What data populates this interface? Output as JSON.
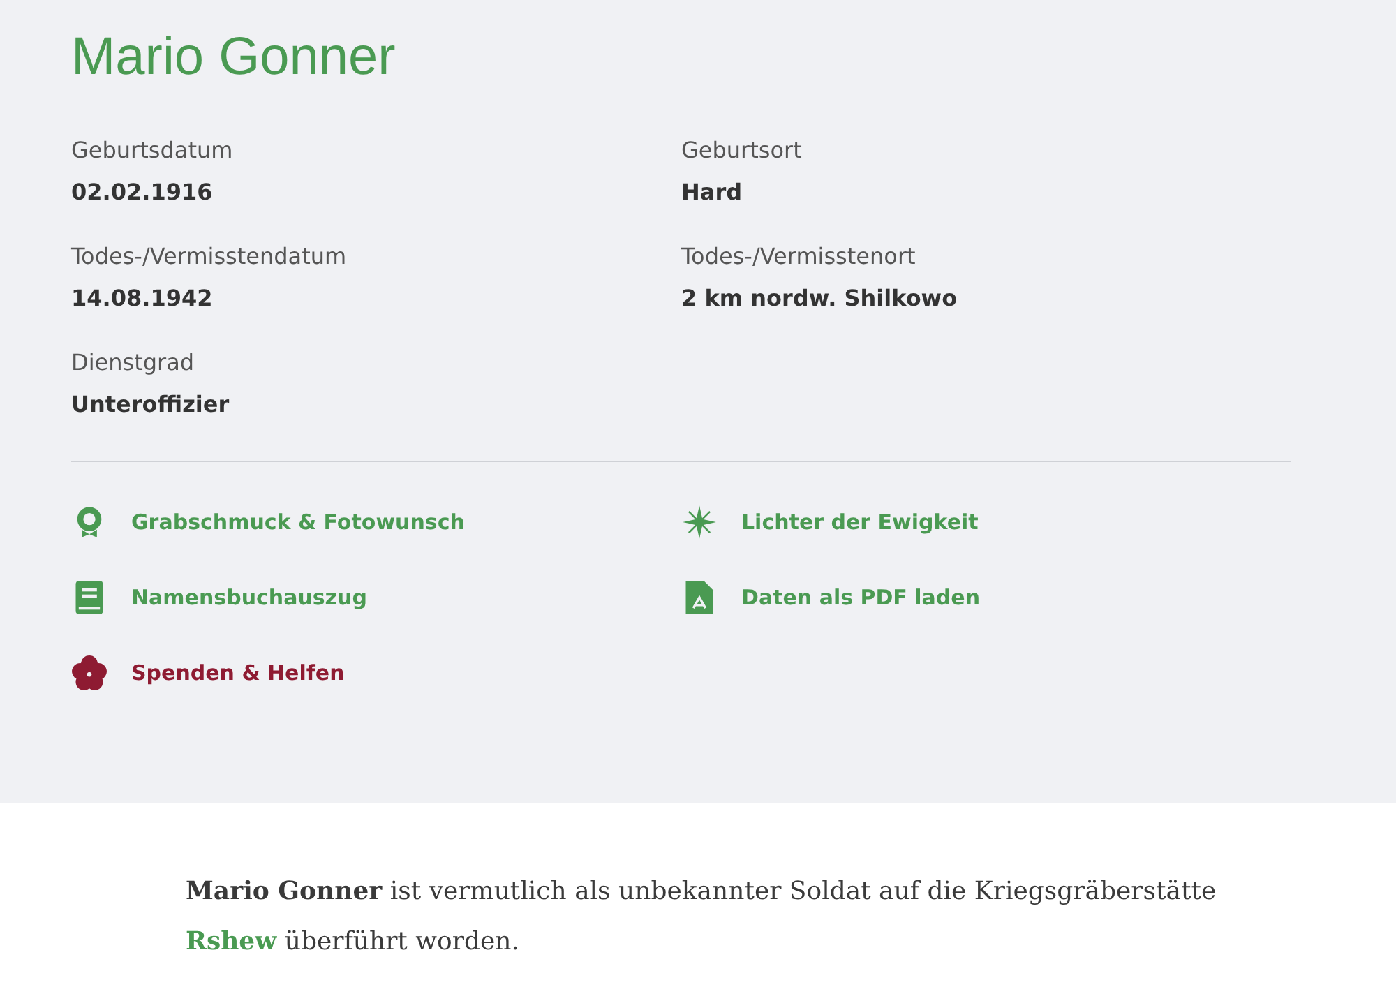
{
  "title": "Mario Gonner",
  "fields": [
    {
      "label": "Geburtsdatum",
      "value": "02.02.1916"
    },
    {
      "label": "Geburtsort",
      "value": "Hard"
    },
    {
      "label": "Todes-/Vermisstendatum",
      "value": "14.08.1942"
    },
    {
      "label": "Todes-/Vermisstenort",
      "value": "2 km nordw. Shilkowo"
    },
    {
      "label": "Dienstgrad",
      "value": "Unteroffizier"
    }
  ],
  "actions": [
    {
      "kind": "wreath",
      "label": "Grabschmuck & Fotowunsch",
      "color": "#4a9a52"
    },
    {
      "kind": "star",
      "label": "Lichter der Ewigkeit",
      "color": "#4a9a52"
    },
    {
      "kind": "book",
      "label": "Namensbuchauszug",
      "color": "#4a9a52"
    },
    {
      "kind": "pdf",
      "label": "Daten als PDF laden",
      "color": "#4a9a52"
    },
    {
      "kind": "flower",
      "label": "Spenden & Helfen",
      "color": "#8e1b32"
    }
  ],
  "note": {
    "text": "**Mario Gonner** ist vermutlich als unbekannter Soldat auf die Kriegsgräberstätte",
    "link": "Rshew",
    "after": " überführt worden."
  }
}
